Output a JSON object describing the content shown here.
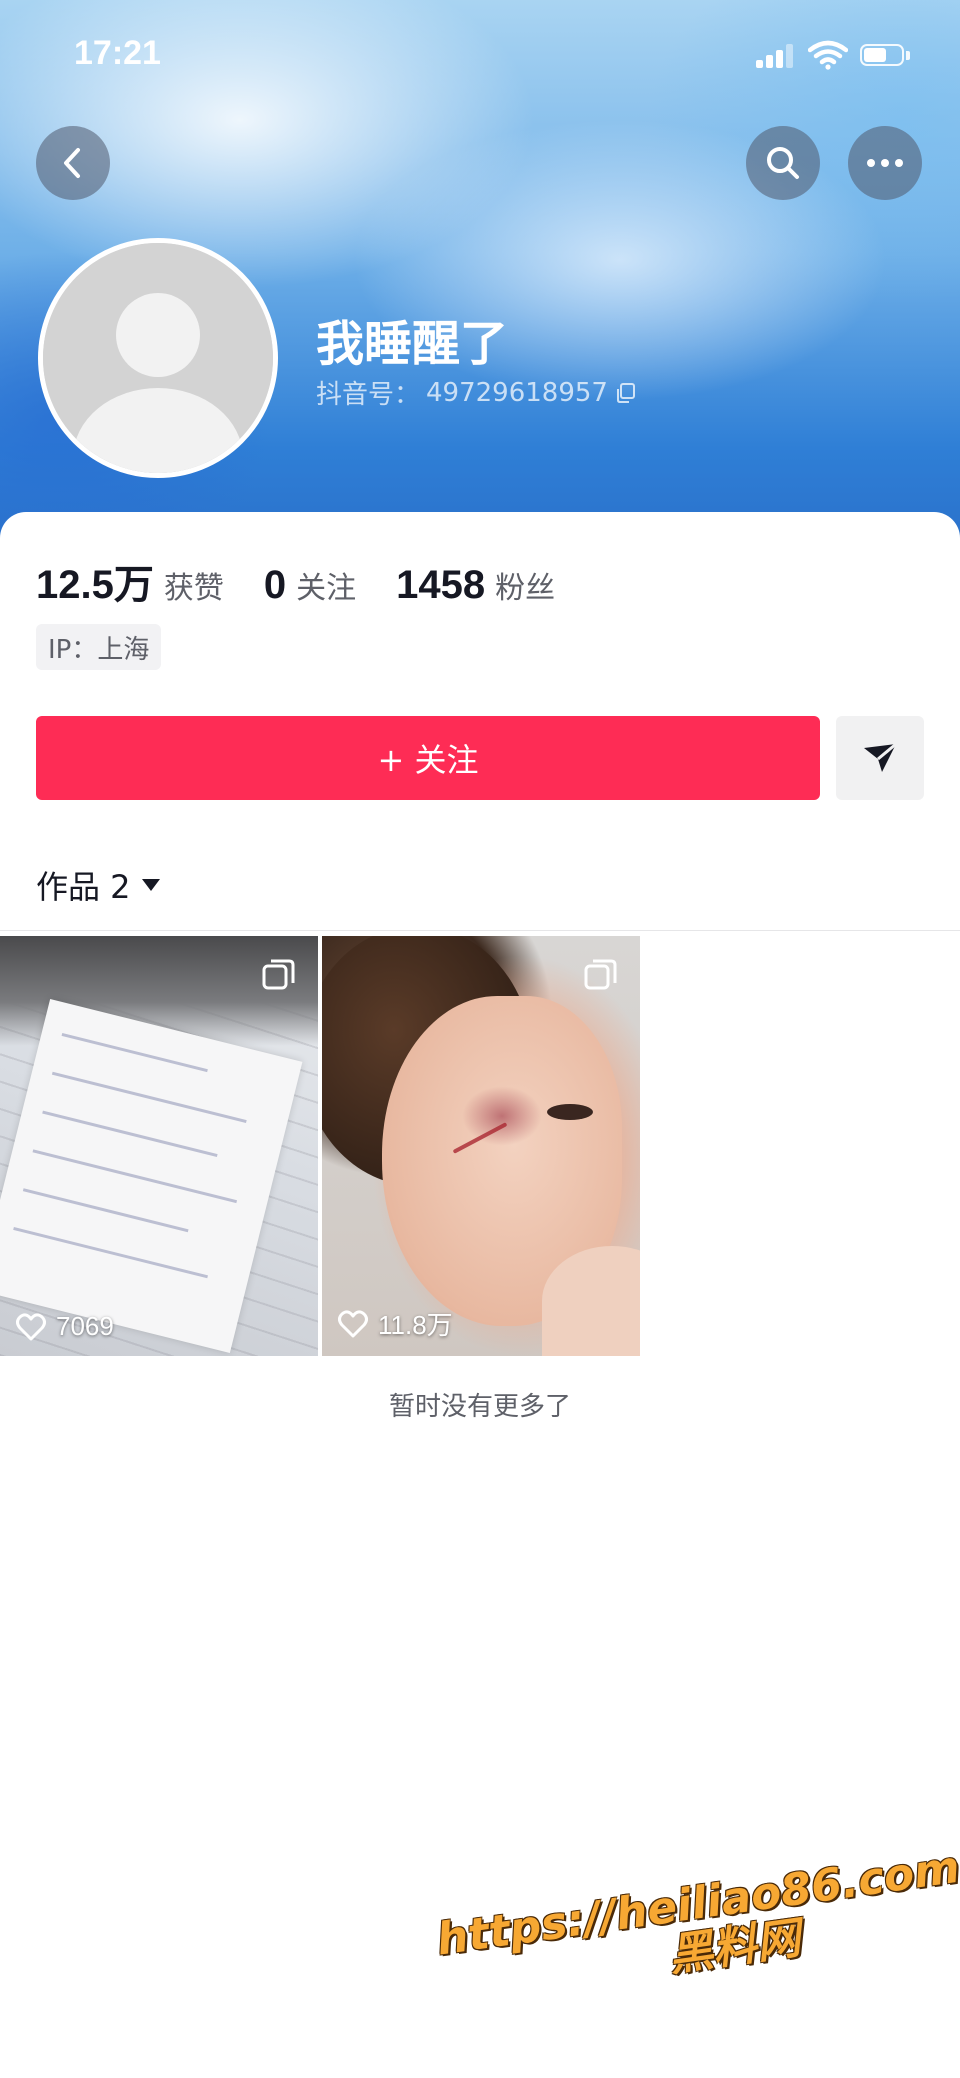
{
  "status_bar": {
    "time": "17:21"
  },
  "header": {
    "back_icon": "chevron-left-icon",
    "search_icon": "search-icon",
    "more_icon": "more-icon"
  },
  "profile": {
    "nickname": "我睡醒了",
    "uid_label": "抖音号：",
    "uid": "49729618957",
    "copy_icon": "copy-icon"
  },
  "stats": [
    {
      "value": "12.5万",
      "label": "获赞"
    },
    {
      "value": "0",
      "label": "关注"
    },
    {
      "value": "1458",
      "label": "粉丝"
    }
  ],
  "ip_tag": "IP：上海",
  "actions": {
    "follow_label": "+ 关注",
    "share_icon": "send-icon"
  },
  "works_tab": {
    "label": "作品 2"
  },
  "posts": [
    {
      "likes": "7069"
    },
    {
      "likes": "11.8万"
    }
  ],
  "footer_text": "暂时没有更多了",
  "watermark": {
    "line1": "https://heiliao86.com",
    "line2": "黑料网"
  },
  "colors": {
    "accent": "#fe2c55",
    "text_primary": "#161823",
    "text_secondary": "#5e6068"
  }
}
